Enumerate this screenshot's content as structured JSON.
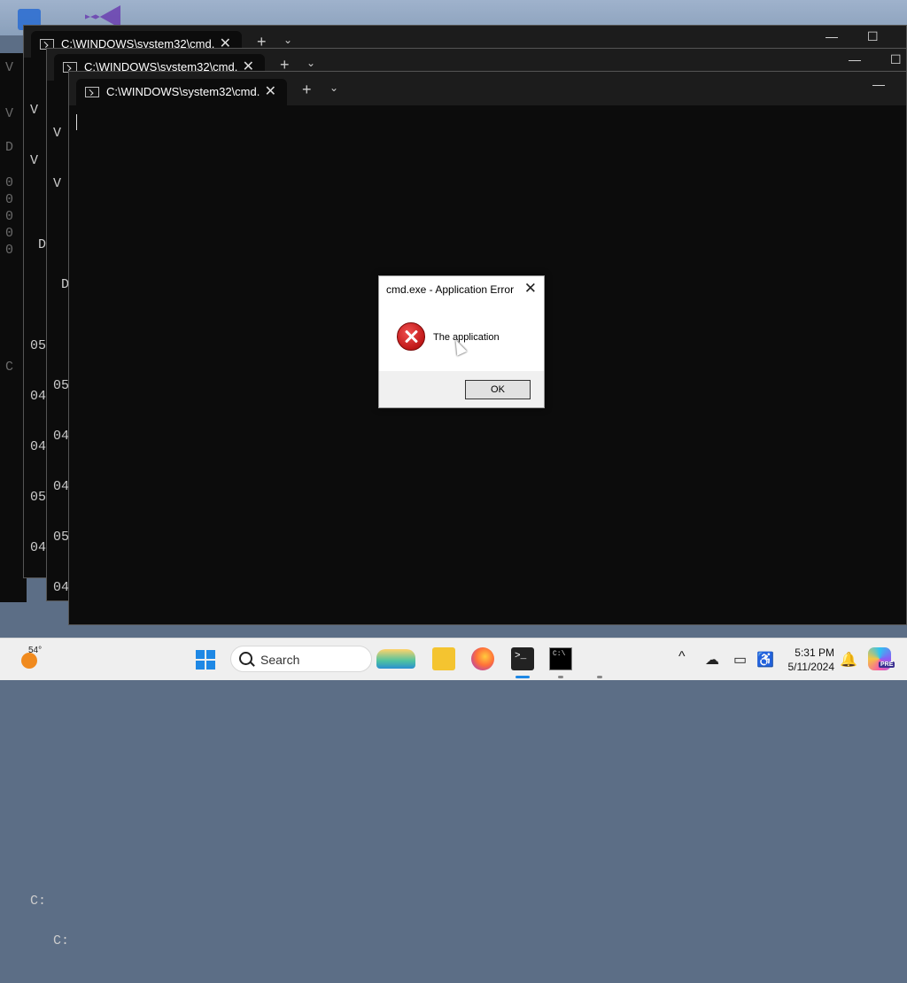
{
  "desktop": {
    "left_strip_lines": [
      "V",
      "V",
      "D",
      "0",
      "0",
      "0",
      "0",
      "0",
      "0",
      "C"
    ]
  },
  "windows": [
    {
      "tab_title": "C:\\WINDOWS\\system32\\cmd.",
      "tab_close": "✕",
      "new_tab": "+",
      "dropdown": "⌄",
      "minimize": "—",
      "maximize": "☐",
      "lines": [
        "V",
        "V",
        "",
        "D",
        "",
        "05",
        "04",
        "04",
        "05",
        "04",
        "",
        "",
        "",
        "",
        "",
        "",
        "C:"
      ]
    },
    {
      "tab_title": "C:\\WINDOWS\\system32\\cmd.",
      "tab_close": "✕",
      "new_tab": "+",
      "dropdown": "⌄",
      "minimize": "—",
      "maximize": "☐",
      "lines": [
        "V",
        "V",
        "",
        "D",
        "",
        "05",
        "04",
        "04",
        "05",
        "04",
        "",
        "",
        "",
        "",
        "",
        "",
        "C:"
      ]
    },
    {
      "tab_title": "C:\\WINDOWS\\system32\\cmd.",
      "tab_close": "✕",
      "new_tab": "+",
      "dropdown": "⌄",
      "minimize": "—"
    }
  ],
  "dialog": {
    "title": "cmd.exe - Application Error",
    "close": "✕",
    "message": "The application",
    "ok_label": "OK",
    "icon": "error-icon"
  },
  "taskbar": {
    "weather_temp": "54°",
    "search_label": "Search",
    "apps": [
      "start-icon",
      "file-explorer-icon",
      "firefox-icon",
      "terminal-icon",
      "cmd-icon"
    ],
    "tray_icons": [
      "chevron-up-icon",
      "cloud-off-icon",
      "display-icon",
      "accessibility-icon"
    ],
    "time": "5:31 PM",
    "date": "5/11/2024",
    "notification_icon": "bell-icon",
    "copilot_badge": "PRE"
  },
  "colors": {
    "terminal_bg": "#0c0c0c",
    "taskbar_bg": "#efefef",
    "error_red": "#c01818",
    "accent": "#1e88e5"
  }
}
